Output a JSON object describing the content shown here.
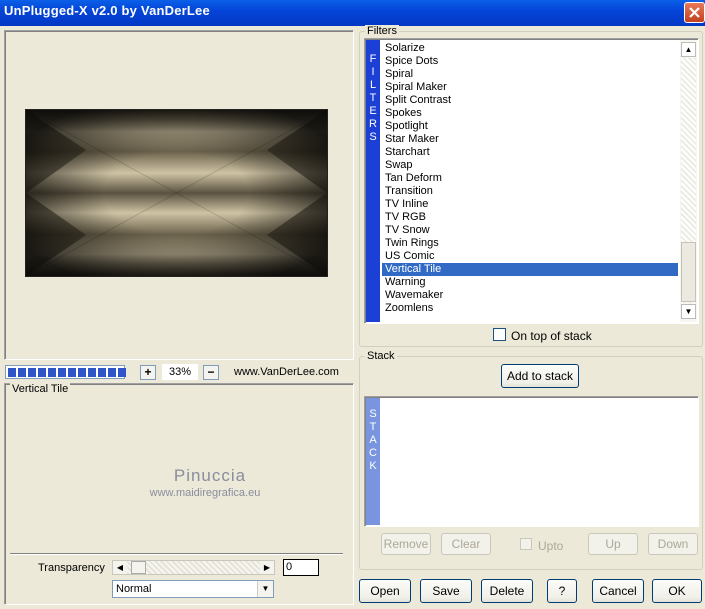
{
  "window": {
    "title": "UnPlugged-X v2.0 by VanDerLee"
  },
  "filters": {
    "group_label": "Filters",
    "sidebar_letters": [
      "F",
      "I",
      "L",
      "T",
      "E",
      "R",
      "S"
    ],
    "items": [
      "Solarize",
      "Spice Dots",
      "Spiral",
      "Spiral Maker",
      "Split Contrast",
      "Spokes",
      "Spotlight",
      "Star Maker",
      "Starchart",
      "Swap",
      "Tan Deform",
      "Transition",
      "TV Inline",
      "TV RGB",
      "TV Snow",
      "Twin Rings",
      "US Comic",
      "Vertical Tile",
      "Warning",
      "Wavemaker",
      "Zoomlens"
    ],
    "selected": "Vertical Tile",
    "on_top_label": "On top of stack"
  },
  "zoom": {
    "value": "33%",
    "plus": "+",
    "minus": "−",
    "progress_blocks": 12
  },
  "website": "www.VanDerLee.com",
  "settings": {
    "group_label": "Vertical Tile"
  },
  "watermark": {
    "name": "Pinuccia",
    "url": "www.maidiregrafica.eu"
  },
  "transparency": {
    "label": "Transparency",
    "value": "0",
    "level": 0.03
  },
  "blend": {
    "selected": "Normal"
  },
  "stack": {
    "group_label": "Stack",
    "add_button": "Add to stack",
    "sidebar_letters": [
      "S",
      "T",
      "A",
      "C",
      "K"
    ],
    "remove": "Remove",
    "clear": "Clear",
    "upto": "Upto",
    "up": "Up",
    "down": "Down"
  },
  "footer": {
    "open": "Open",
    "save": "Save",
    "delete": "Delete",
    "help": "?",
    "cancel": "Cancel",
    "ok": "OK"
  }
}
